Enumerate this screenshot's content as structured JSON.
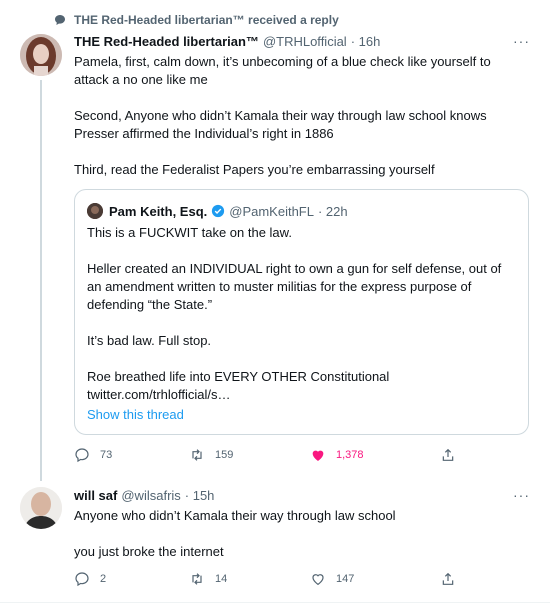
{
  "context": {
    "text": "THE Red-Headed libertarian™ received a reply"
  },
  "tweet1": {
    "name": "THE Red-Headed libertarian™",
    "handle": "@TRHLofficial",
    "time": "· 16h",
    "more": "···",
    "paragraphs": [
      "Pamela, first, calm down, it’s unbecoming of a blue check like yourself to attack a no one like me",
      "Second, Anyone who didn’t Kamala their way through law school knows Presser affirmed the Individual’s right in 1886",
      "Third, read the Federalist Papers you’re embarrassing yourself"
    ],
    "quote": {
      "name": "Pam Keith, Esq.",
      "handle": "@PamKeithFL",
      "time": "· 22h",
      "paragraphs": [
        "This is a FUCKWIT take on the law.",
        "Heller created an INDIVIDUAL right to own a gun for self defense, out of an amendment written to muster militias for the express purpose of defending “the State.”",
        "It’s bad law.  Full stop.",
        "Roe breathed life into EVERY OTHER Constitutional"
      ],
      "link": "twitter.com/trhlofficial/s…",
      "show_thread": "Show this thread"
    },
    "actions": {
      "replies": "73",
      "retweets": "159",
      "likes": "1,378"
    }
  },
  "tweet2": {
    "name": "will saf",
    "handle": "@wilsafris",
    "time": "· 15h",
    "more": "···",
    "paragraphs": [
      "Anyone who didn’t Kamala their way through law school",
      "you just broke the internet"
    ],
    "actions": {
      "replies": "2",
      "retweets": "14",
      "likes": "147"
    }
  },
  "colors": {
    "like_active": "#f91880",
    "link": "#1d9bf0",
    "muted": "#536471",
    "verified": "#1d9bf0"
  }
}
